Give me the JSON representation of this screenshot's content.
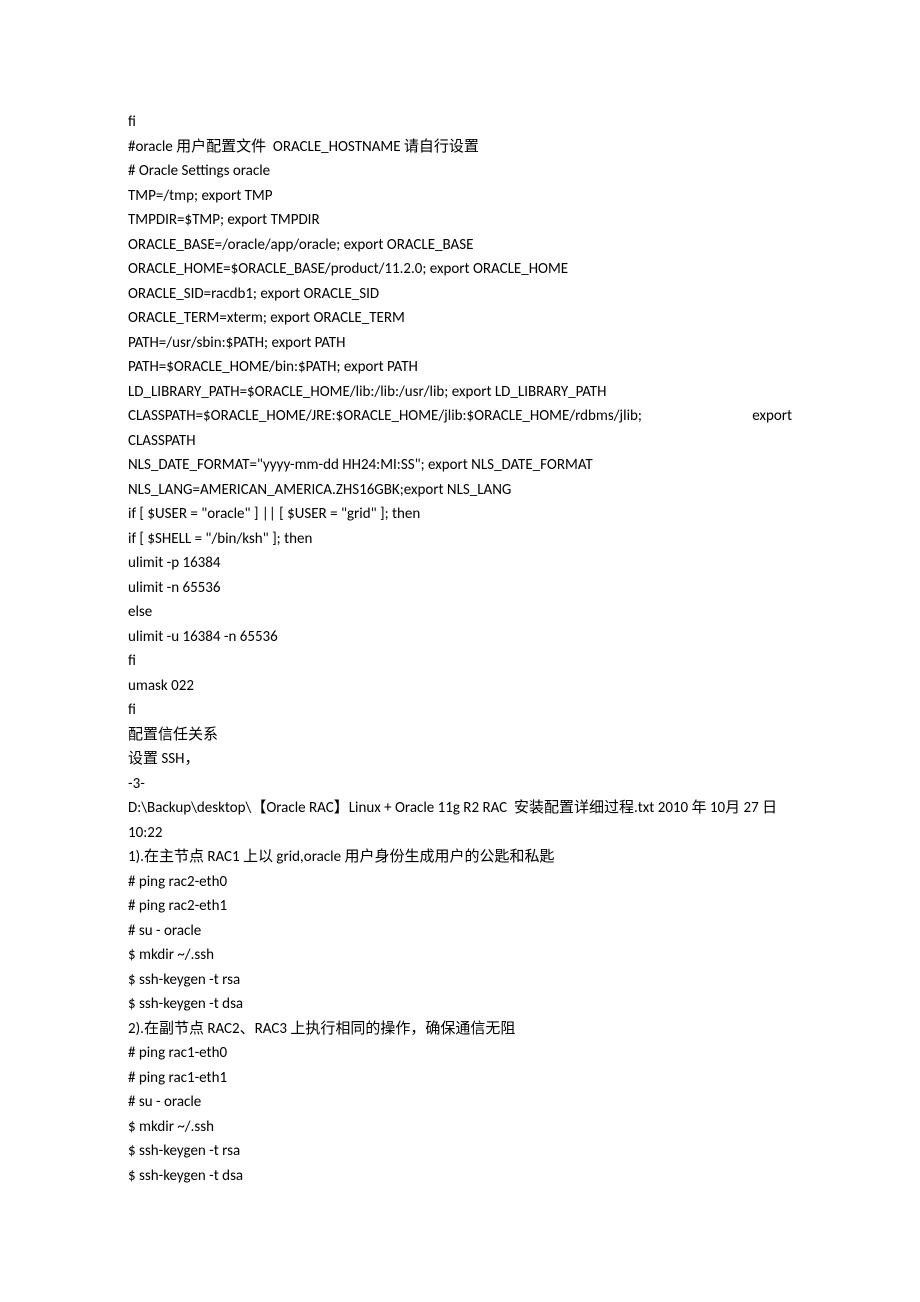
{
  "lines": [
    "fi",
    "#oracle 用户配置文件  ORACLE_HOSTNAME 请自行设置",
    "# Oracle Settings oracle",
    "TMP=/tmp; export TMP",
    "TMPDIR=$TMP; export TMPDIR",
    "ORACLE_BASE=/oracle/app/oracle; export ORACLE_BASE",
    "ORACLE_HOME=$ORACLE_BASE/product/11.2.0; export ORACLE_HOME",
    "ORACLE_SID=racdb1; export ORACLE_SID",
    "ORACLE_TERM=xterm; export ORACLE_TERM",
    "PATH=/usr/sbin:$PATH; export PATH",
    "PATH=$ORACLE_HOME/bin:$PATH; export PATH",
    "LD_LIBRARY_PATH=$ORACLE_HOME/lib:/lib:/usr/lib; export LD_LIBRARY_PATH"
  ],
  "justify_line": {
    "left": "CLASSPATH=$ORACLE_HOME/JRE:$ORACLE_HOME/jlib:$ORACLE_HOME/rdbms/jlib;",
    "right": "export"
  },
  "lines2": [
    "CLASSPATH",
    "NLS_DATE_FORMAT=\"yyyy-mm-dd HH24:MI:SS\"; export NLS_DATE_FORMAT",
    "NLS_LANG=AMERICAN_AMERICA.ZHS16GBK;export NLS_LANG",
    "if [ $USER = \"oracle\" ] || [ $USER = \"grid\" ]; then",
    "if [ $SHELL = \"/bin/ksh\" ]; then",
    "ulimit -p 16384",
    "ulimit -n 65536",
    "else",
    "ulimit -u 16384 -n 65536",
    "fi",
    "umask 022",
    "fi",
    "配置信任关系",
    "设置 SSH，",
    "-3-",
    "D:\\Backup\\desktop\\【Oracle RAC】Linux + Oracle 11g R2 RAC  安装配置详细过程.txt 2010 年 10月 27 日  10:22",
    "1).在主节点 RAC1 上以 grid,oracle 用户身份生成用户的公匙和私匙",
    "# ping rac2-eth0",
    "# ping rac2-eth1",
    "# su - oracle",
    "$ mkdir ~/.ssh",
    "$ ssh-keygen -t rsa",
    "$ ssh-keygen -t dsa",
    "2).在副节点 RAC2、RAC3 上执行相同的操作，确保通信无阻",
    "# ping rac1-eth0",
    "# ping rac1-eth1",
    "# su - oracle",
    "$ mkdir ~/.ssh",
    "$ ssh-keygen -t rsa",
    "$ ssh-keygen -t dsa"
  ]
}
